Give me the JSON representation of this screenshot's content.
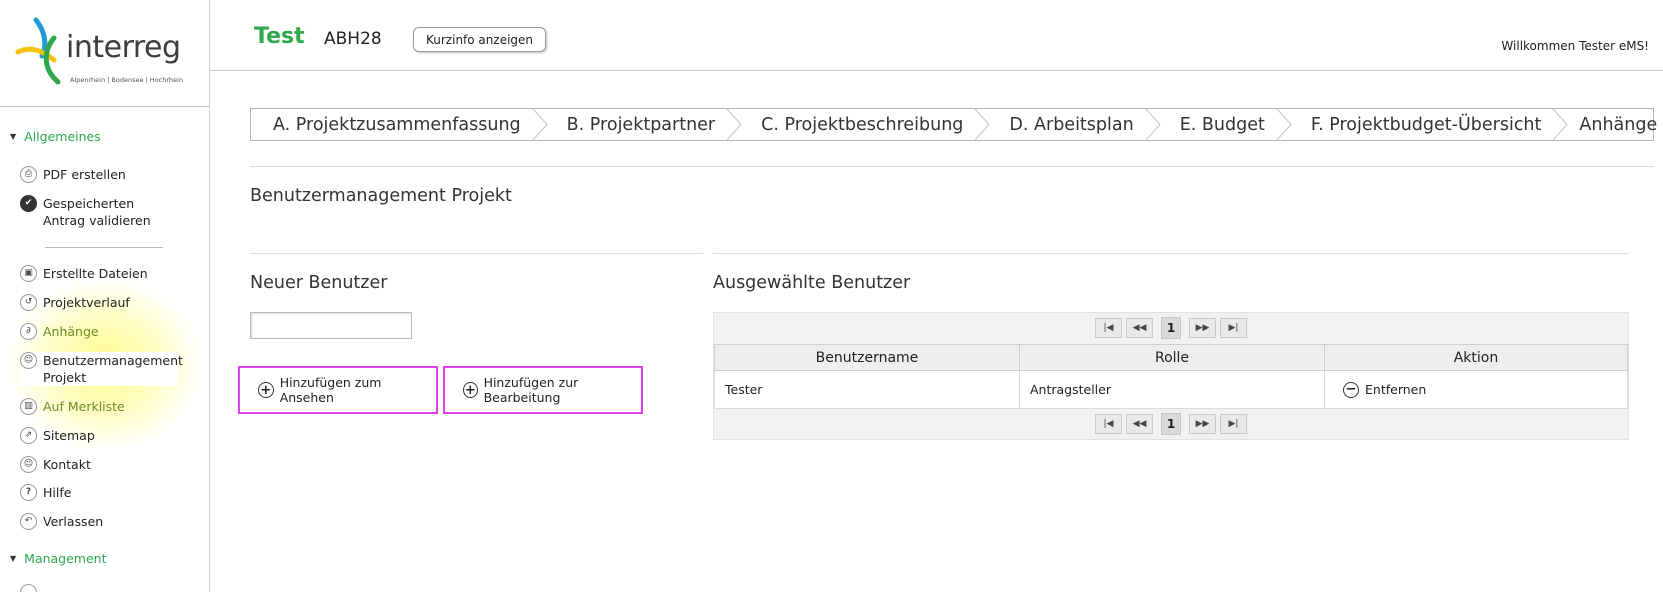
{
  "logo": {
    "wordmark": "interreg",
    "subtitle": "Alpenrhein | Bodensee | Hochrhein"
  },
  "sidebar": {
    "section_general": "Allgemeines",
    "items_top": [
      {
        "label": "PDF erstellen",
        "icon": "printer-icon"
      },
      {
        "label": "Gespeicherten Antrag validieren",
        "icon": "check-circle-icon"
      }
    ],
    "items": [
      {
        "label": "Erstellte Dateien",
        "icon": "save-icon"
      },
      {
        "label": "Projektverlauf",
        "icon": "history-icon"
      },
      {
        "label": "Anhänge",
        "icon": "paperclip-icon"
      },
      {
        "label": "Benutzermanagement Projekt",
        "icon": "user-icon"
      },
      {
        "label": "Auf Merkliste",
        "icon": "bookmark-icon"
      },
      {
        "label": "Sitemap",
        "icon": "external-link-icon"
      },
      {
        "label": "Kontakt",
        "icon": "contact-icon"
      },
      {
        "label": "Hilfe",
        "icon": "help-icon"
      },
      {
        "label": "Verlassen",
        "icon": "exit-icon"
      }
    ],
    "section_management": "Management"
  },
  "header": {
    "title": "Test",
    "code": "ABH28",
    "info_button": "Kurzinfo anzeigen",
    "welcome": "Willkommen Tester eMS!"
  },
  "steps": [
    "A. Projektzusammenfassung",
    "B. Projektpartner",
    "C. Projektbeschreibung",
    "D. Arbeitsplan",
    "E. Budget",
    "F. Projektbudget-Übersicht",
    "Anhänge"
  ],
  "page": {
    "heading": "Benutzermanagement Projekt",
    "new_user_heading": "Neuer Benutzer",
    "new_user_value": "",
    "add_view_button": "Hinzufügen zum Ansehen",
    "add_edit_button": "Hinzufügen zur Bearbeitung",
    "selected_heading": "Ausgewählte Benutzer"
  },
  "table": {
    "columns": [
      "Benutzername",
      "Rolle",
      "Aktion"
    ],
    "rows": [
      {
        "username": "Tester",
        "role": "Antragsteller",
        "action": "Entfernen"
      }
    ],
    "pager": {
      "first": "|◀",
      "prev": "◀◀",
      "page": "1",
      "next": "▶▶",
      "last": "▶|"
    }
  },
  "colors": {
    "accent_green": "#2ea84a",
    "highlight_magenta": "#e040e6",
    "highlight_yellow": "#fffa78"
  }
}
